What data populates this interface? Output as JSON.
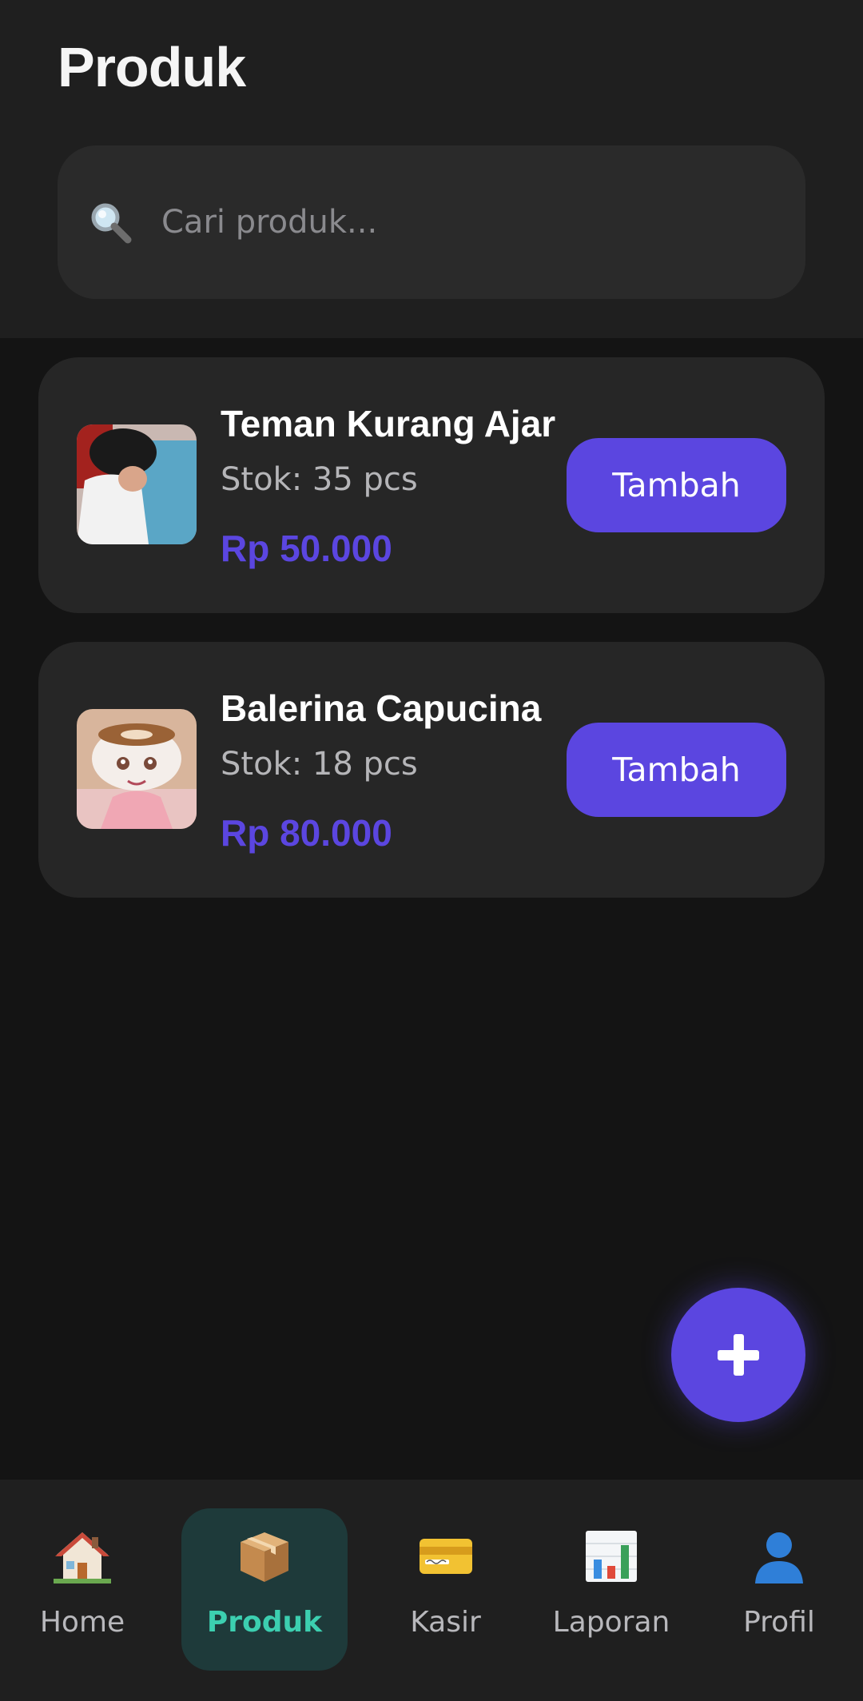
{
  "header": {
    "title": "Produk"
  },
  "search": {
    "placeholder": "Cari produk...",
    "value": ""
  },
  "products": [
    {
      "name": "Teman Kurang Ajar",
      "stock": "Stok: 35 pcs",
      "price": "Rp 50.000",
      "button_label": "Tambah"
    },
    {
      "name": "Balerina Capucina",
      "stock": "Stok: 18 pcs",
      "price": "Rp 80.000",
      "button_label": "Tambah"
    }
  ],
  "fab": {
    "icon": "plus-icon"
  },
  "bottom_nav": {
    "active": "Produk",
    "items": [
      {
        "label": "Home",
        "icon": "home-icon"
      },
      {
        "label": "Produk",
        "icon": "package-icon"
      },
      {
        "label": "Kasir",
        "icon": "credit-card-icon"
      },
      {
        "label": "Laporan",
        "icon": "bar-chart-icon"
      },
      {
        "label": "Profil",
        "icon": "user-icon"
      }
    ]
  },
  "colors": {
    "background": "#141414",
    "surface": "#1f1f1f",
    "card": "#262626",
    "accent": "#5b46e0",
    "active_nav_bg": "#1e3a3a",
    "active_nav_text": "#3ccfb0"
  }
}
